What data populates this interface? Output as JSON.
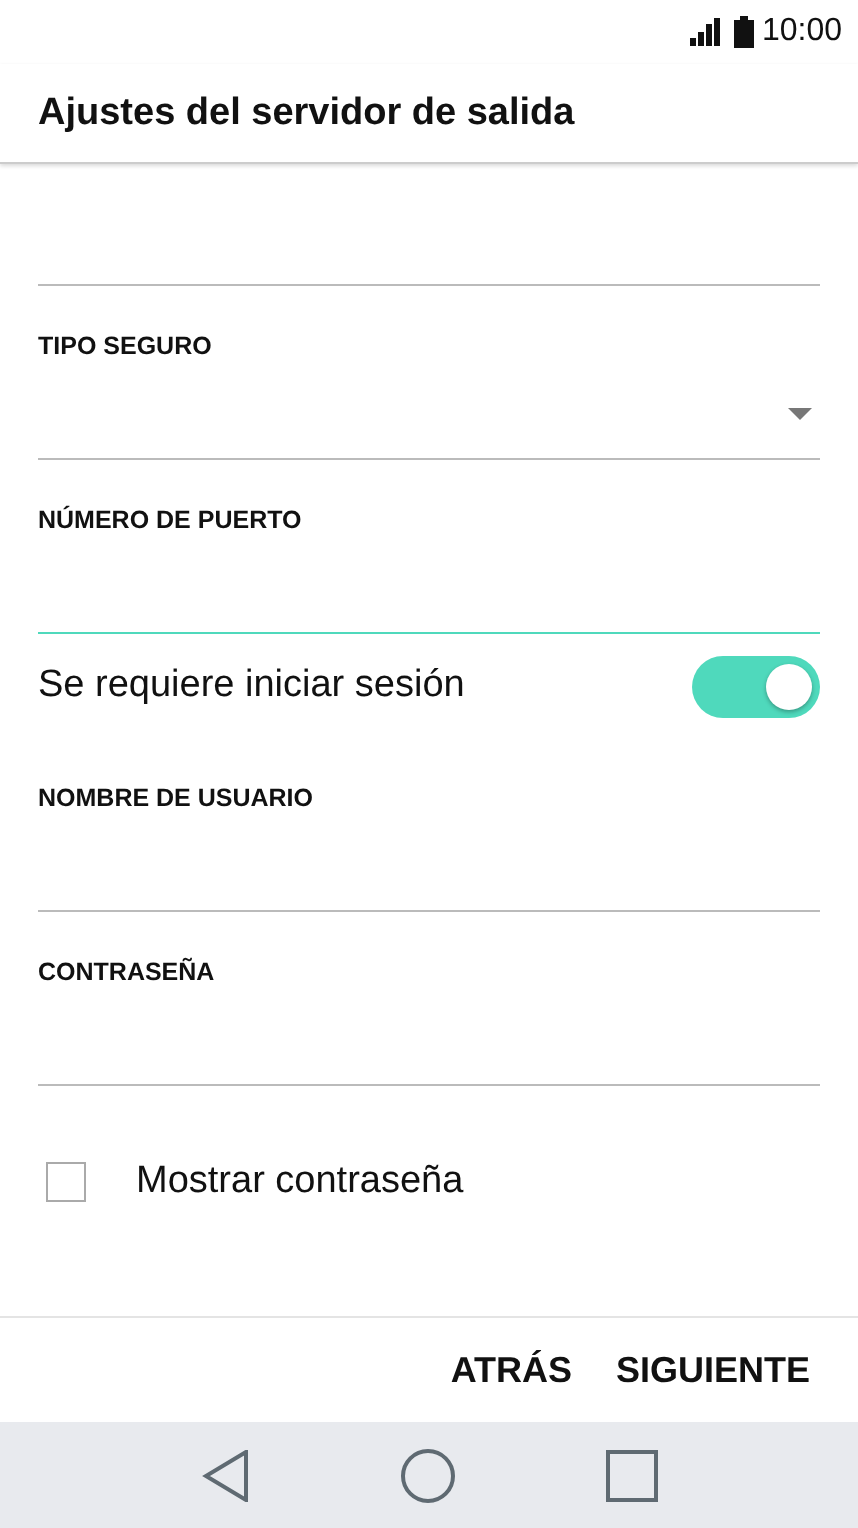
{
  "status_bar": {
    "time": "10:00"
  },
  "title": "Ajustes del servidor de salida",
  "items": [
    {
      "kind": "field",
      "focused": false
    },
    {
      "kind": "dropdown",
      "label": "TIPO SEGURO",
      "focused": false
    },
    {
      "kind": "field",
      "label": "NÚMERO DE PUERTO",
      "focused": true
    },
    {
      "kind": "switch",
      "label": "Se requiere iniciar sesión",
      "on": true
    },
    {
      "kind": "field",
      "label": "NOMBRE DE USUARIO",
      "focused": false
    },
    {
      "kind": "field",
      "label": "CONTRASEÑA",
      "focused": false
    },
    {
      "kind": "checkbox",
      "label": "Mostrar contraseña",
      "checked": false
    }
  ],
  "buttons": [
    "ATRÁS",
    "SIGUIENTE"
  ]
}
